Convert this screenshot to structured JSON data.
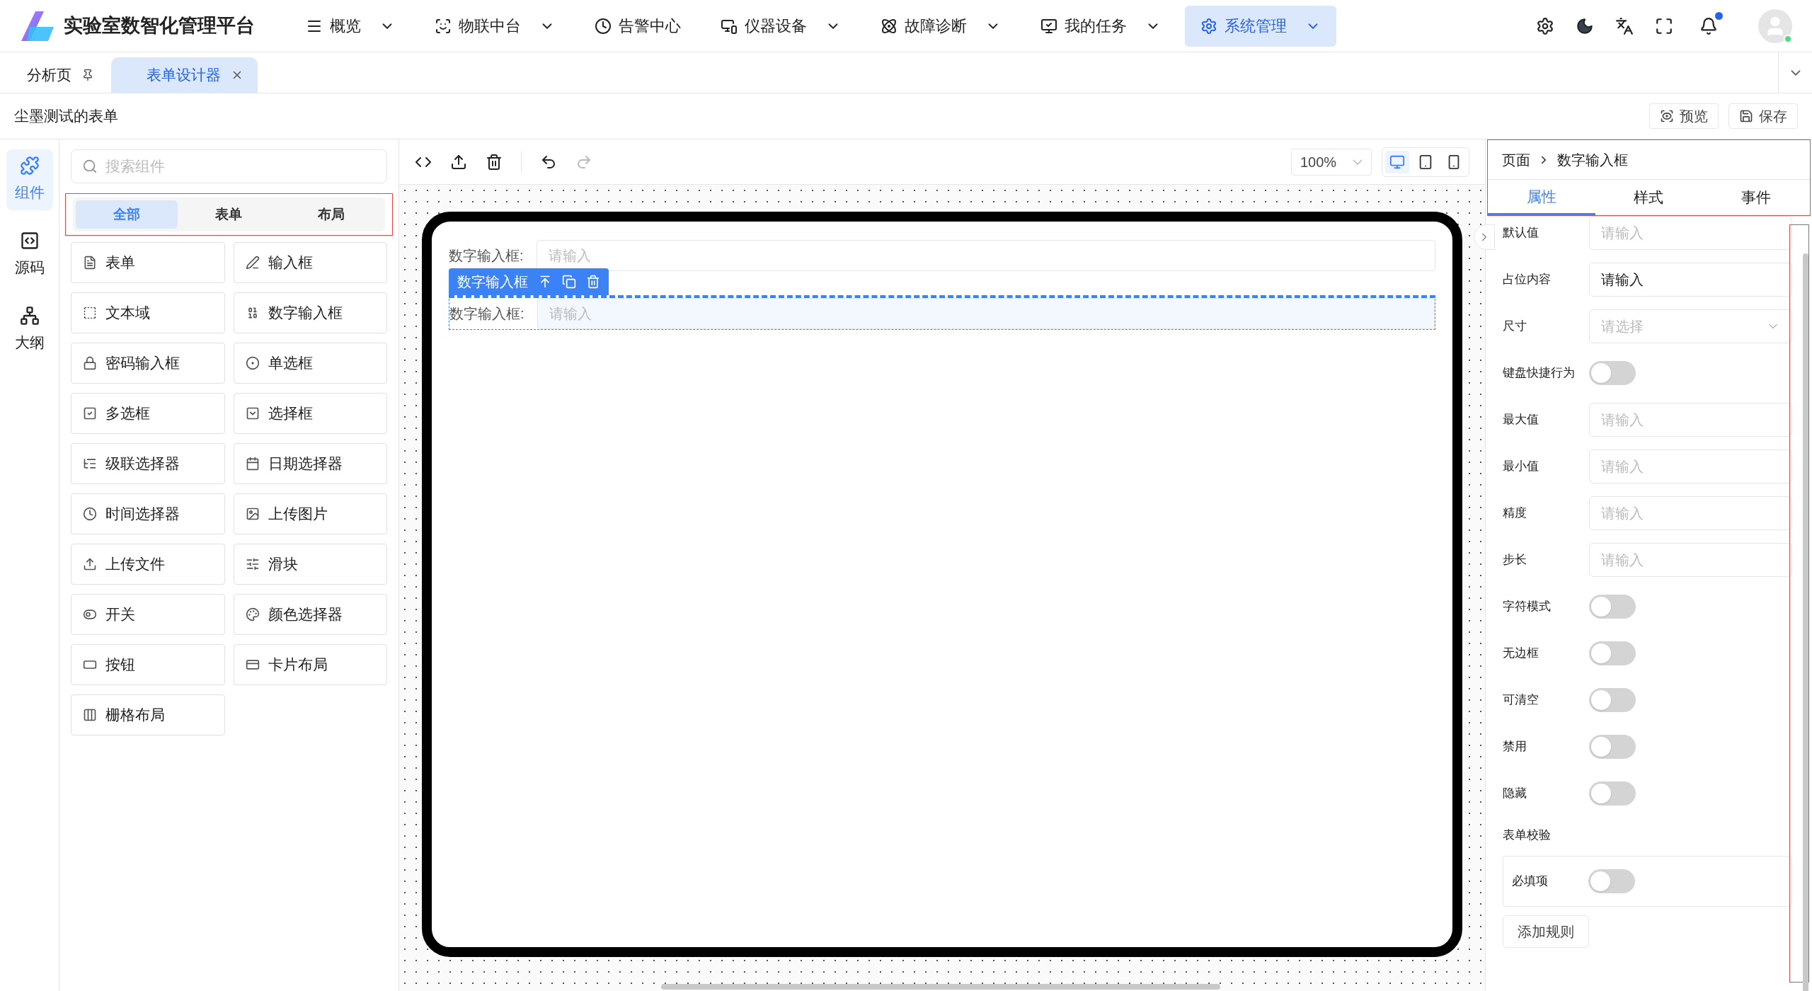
{
  "app": {
    "title": "实验室数智化管理平台"
  },
  "nav": [
    {
      "label": "概览",
      "dropdown": true,
      "selected": false
    },
    {
      "label": "物联中台",
      "dropdown": true,
      "selected": false
    },
    {
      "label": "告警中心",
      "dropdown": false,
      "selected": false
    },
    {
      "label": "仪器设备",
      "dropdown": true,
      "selected": false
    },
    {
      "label": "故障诊断",
      "dropdown": true,
      "selected": false
    },
    {
      "label": "我的任务",
      "dropdown": true,
      "selected": false
    },
    {
      "label": "系统管理",
      "dropdown": true,
      "selected": true
    }
  ],
  "header_tools": {
    "notification_dot": true,
    "online": true
  },
  "page_tabs": [
    {
      "label": "分析页",
      "pinned": true,
      "closable": false,
      "selected": false
    },
    {
      "label": "表单设计器",
      "pinned": false,
      "closable": true,
      "selected": true
    }
  ],
  "form_title": "尘墨测试的表单",
  "actions": [
    {
      "label": "预览"
    },
    {
      "label": "保存"
    }
  ],
  "rail": [
    {
      "label": "组件",
      "selected": true
    },
    {
      "label": "源码",
      "selected": false
    },
    {
      "label": "大纲",
      "selected": false
    }
  ],
  "search": {
    "placeholder": "搜索组件"
  },
  "component_tabs": [
    {
      "label": "全部",
      "selected": true
    },
    {
      "label": "表单",
      "selected": false
    },
    {
      "label": "布局",
      "selected": false
    }
  ],
  "components": [
    "表单",
    "输入框",
    "文本域",
    "数字输入框",
    "密码输入框",
    "单选框",
    "多选框",
    "选择框",
    "级联选择器",
    "日期选择器",
    "时间选择器",
    "上传图片",
    "上传文件",
    "滑块",
    "开关",
    "颜色选择器",
    "按钮",
    "卡片布局",
    "栅格布局"
  ],
  "toolbar": {
    "zoom": "100%",
    "devices": [
      {
        "kind": "desktop",
        "selected": true
      },
      {
        "kind": "tablet",
        "selected": false
      },
      {
        "kind": "phone",
        "selected": false
      }
    ]
  },
  "canvas_fields": [
    {
      "label": "数字输入框:",
      "placeholder": "请输入",
      "selected": false
    },
    {
      "label": "数字输入框:",
      "placeholder": "请输入",
      "selected": true
    }
  ],
  "selected_badge": {
    "label": "数字输入框"
  },
  "inspector": {
    "breadcrumb": [
      "页面",
      "数字输入框"
    ],
    "tabs": [
      {
        "label": "属性",
        "selected": true
      },
      {
        "label": "样式",
        "selected": false
      },
      {
        "label": "事件",
        "selected": false
      }
    ],
    "properties": [
      {
        "kind": "input",
        "label": "默认值",
        "placeholder": "请输入"
      },
      {
        "kind": "input",
        "label": "占位内容",
        "value": "请输入"
      },
      {
        "kind": "select",
        "label": "尺寸",
        "placeholder": "请选择"
      },
      {
        "kind": "switch",
        "label": "键盘快捷行为",
        "on": false
      },
      {
        "kind": "input",
        "label": "最大值",
        "placeholder": "请输入"
      },
      {
        "kind": "input",
        "label": "最小值",
        "placeholder": "请输入"
      },
      {
        "kind": "input",
        "label": "精度",
        "placeholder": "请输入"
      },
      {
        "kind": "input",
        "label": "步长",
        "placeholder": "请输入"
      },
      {
        "kind": "switch",
        "label": "字符模式",
        "on": false
      },
      {
        "kind": "switch",
        "label": "无边框",
        "on": false
      },
      {
        "kind": "switch",
        "label": "可清空",
        "on": false
      },
      {
        "kind": "switch",
        "label": "禁用",
        "on": false
      },
      {
        "kind": "switch",
        "label": "隐藏",
        "on": false
      }
    ],
    "validation": {
      "title": "表单校验",
      "required": {
        "label": "必填项",
        "on": false
      },
      "add_button": "添加规则"
    }
  }
}
